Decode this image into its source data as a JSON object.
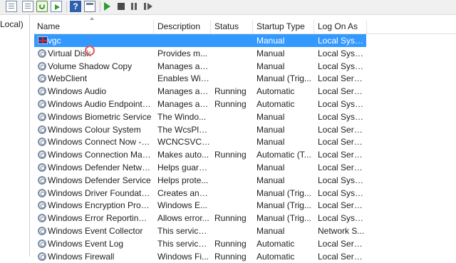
{
  "left_pane": {
    "tree_label": "Local)"
  },
  "toolbar": {
    "icons": [
      "list-icon",
      "list-icon",
      "refresh-icon",
      "export-icon",
      "help-icon",
      "properties-icon",
      "start-icon",
      "stop-icon",
      "pause-icon",
      "resume-icon"
    ],
    "help_glyph": "?"
  },
  "columns": {
    "name": "Name",
    "description": "Description",
    "status": "Status",
    "startup_type": "Startup Type",
    "log_on_as": "Log On As"
  },
  "services": [
    {
      "name": "vgc",
      "description": "",
      "status": "",
      "startup": "Manual",
      "logon": "Local Syste...",
      "icon": "uk-flag-icon",
      "selected": true
    },
    {
      "name": "Virtual Disk",
      "description": "Provides m...",
      "status": "",
      "startup": "Manual",
      "logon": "Local Syste...",
      "icon": "gear-icon"
    },
    {
      "name": "Volume Shadow Copy",
      "description": "Manages an...",
      "status": "",
      "startup": "Manual",
      "logon": "Local Syste...",
      "icon": "gear-icon"
    },
    {
      "name": "WebClient",
      "description": "Enables Win...",
      "status": "",
      "startup": "Manual (Trig...",
      "logon": "Local Service",
      "icon": "gear-icon"
    },
    {
      "name": "Windows Audio",
      "description": "Manages au...",
      "status": "Running",
      "startup": "Automatic",
      "logon": "Local Service",
      "icon": "gear-icon"
    },
    {
      "name": "Windows Audio Endpoint B...",
      "description": "Manages au...",
      "status": "Running",
      "startup": "Automatic",
      "logon": "Local Syste...",
      "icon": "gear-icon"
    },
    {
      "name": "Windows Biometric Service",
      "description": "The Windo...",
      "status": "",
      "startup": "Manual",
      "logon": "Local Syste...",
      "icon": "gear-icon"
    },
    {
      "name": "Windows Colour System",
      "description": "The WcsPlu...",
      "status": "",
      "startup": "Manual",
      "logon": "Local Service",
      "icon": "gear-icon"
    },
    {
      "name": "Windows Connect Now - C...",
      "description": "WCNCSVC ...",
      "status": "",
      "startup": "Manual",
      "logon": "Local Service",
      "icon": "gear-icon"
    },
    {
      "name": "Windows Connection Mana...",
      "description": "Makes auto...",
      "status": "Running",
      "startup": "Automatic (T...",
      "logon": "Local Service",
      "icon": "gear-icon"
    },
    {
      "name": "Windows Defender Networ...",
      "description": "Helps guard...",
      "status": "",
      "startup": "Manual",
      "logon": "Local Service",
      "icon": "gear-icon"
    },
    {
      "name": "Windows Defender Service",
      "description": "Helps prote...",
      "status": "",
      "startup": "Manual",
      "logon": "Local Syste...",
      "icon": "gear-icon"
    },
    {
      "name": "Windows Driver Foundation...",
      "description": "Creates and...",
      "status": "",
      "startup": "Manual (Trig...",
      "logon": "Local Syste...",
      "icon": "gear-icon"
    },
    {
      "name": "Windows Encryption Provid...",
      "description": "Windows E...",
      "status": "",
      "startup": "Manual (Trig...",
      "logon": "Local Service",
      "icon": "gear-icon"
    },
    {
      "name": "Windows Error Reporting Se...",
      "description": "Allows error...",
      "status": "Running",
      "startup": "Manual (Trig...",
      "logon": "Local Syste...",
      "icon": "gear-icon"
    },
    {
      "name": "Windows Event Collector",
      "description": "This service ...",
      "status": "",
      "startup": "Manual",
      "logon": "Network S...",
      "icon": "gear-icon"
    },
    {
      "name": "Windows Event Log",
      "description": "This service ...",
      "status": "Running",
      "startup": "Automatic",
      "logon": "Local Service",
      "icon": "gear-icon"
    },
    {
      "name": "Windows Firewall",
      "description": "Windows Fi...",
      "status": "Running",
      "startup": "Automatic",
      "logon": "Local Service",
      "icon": "gear-icon"
    }
  ],
  "colors": {
    "selection": "#3399ff",
    "header_border": "#e0e0e0"
  }
}
